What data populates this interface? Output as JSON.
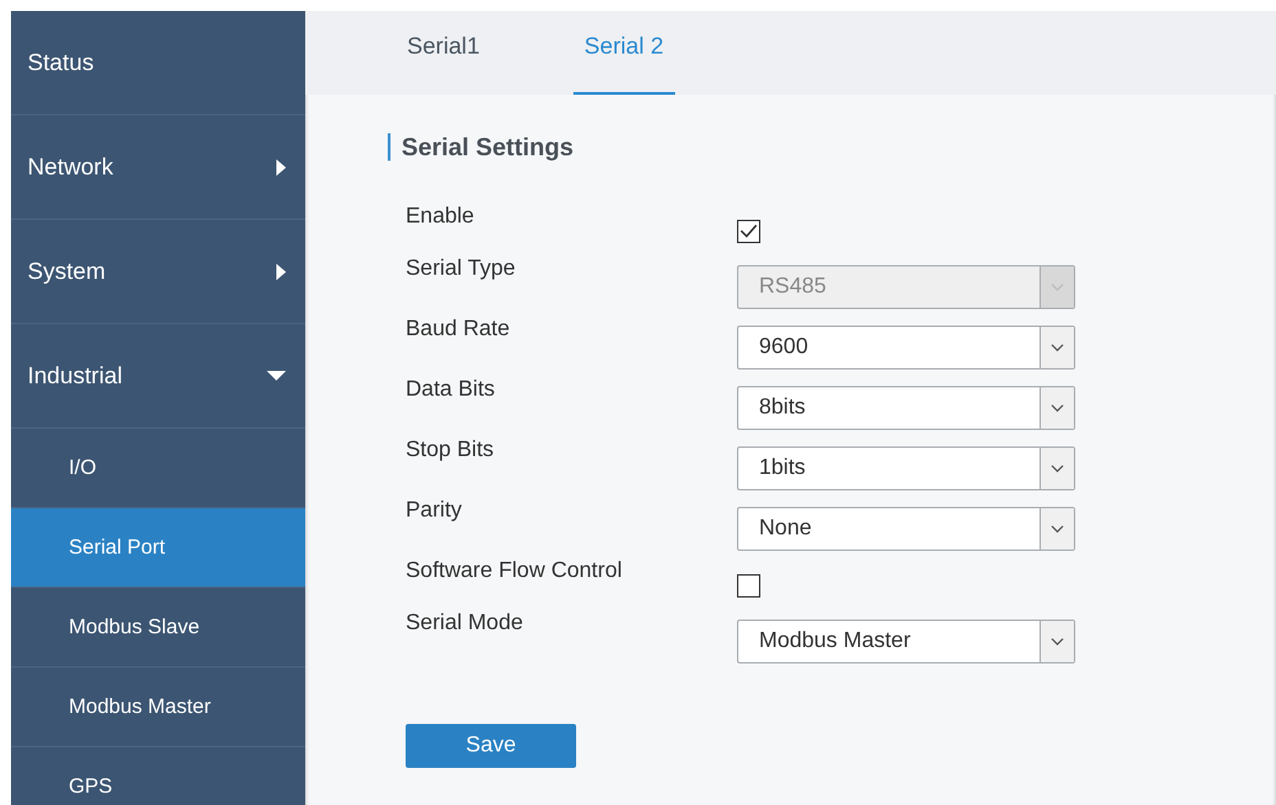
{
  "sidebar": {
    "items": [
      {
        "label": "Status",
        "kind": "menu",
        "selected": false
      },
      {
        "label": "Network",
        "kind": "menu",
        "expanded": false,
        "selected": false
      },
      {
        "label": "System",
        "kind": "menu",
        "expanded": false,
        "selected": false
      },
      {
        "label": "Industrial",
        "kind": "menu",
        "expanded": true,
        "selected": false
      },
      {
        "label": "I/O",
        "kind": "submenu",
        "selected": false
      },
      {
        "label": "Serial Port",
        "kind": "submenu",
        "selected": true
      },
      {
        "label": "Modbus Slave",
        "kind": "submenu",
        "selected": false
      },
      {
        "label": "Modbus Master",
        "kind": "submenu",
        "selected": false
      },
      {
        "label": "GPS",
        "kind": "submenu",
        "selected": false
      }
    ]
  },
  "tabs": [
    {
      "label": "Serial1",
      "selected": false
    },
    {
      "label": "Serial 2",
      "selected": true
    }
  ],
  "section": {
    "title": "Serial Settings"
  },
  "fields": [
    {
      "label": "Enable",
      "kind": "checkbox",
      "checked": true
    },
    {
      "label": "Serial Type",
      "kind": "select",
      "value": "RS485",
      "disabled": true
    },
    {
      "label": "Baud Rate",
      "kind": "select",
      "value": "9600",
      "disabled": false
    },
    {
      "label": "Data Bits",
      "kind": "select",
      "value": "8bits",
      "disabled": false
    },
    {
      "label": "Stop Bits",
      "kind": "select",
      "value": "1bits",
      "disabled": false
    },
    {
      "label": "Parity",
      "kind": "select",
      "value": "None",
      "disabled": false
    },
    {
      "label": "Software Flow Control",
      "kind": "checkbox",
      "checked": false
    },
    {
      "label": "Serial Mode",
      "kind": "select",
      "value": "Modbus Master",
      "disabled": false
    }
  ],
  "save_button": {
    "label": "Save"
  }
}
